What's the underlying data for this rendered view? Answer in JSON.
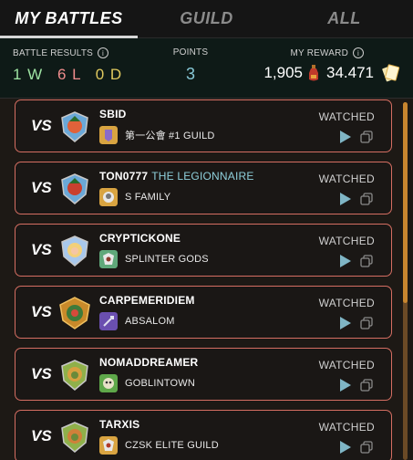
{
  "tabs": [
    {
      "label": "MY BATTLES"
    },
    {
      "label": "GUILD"
    },
    {
      "label": "ALL"
    }
  ],
  "stats": {
    "results_label": "BATTLE RESULTS",
    "wins": "1 W",
    "losses": "6 L",
    "draws": "0 D",
    "points_label": "POINTS",
    "points": "3",
    "reward_label": "MY REWARD",
    "reward_potions": "1,905",
    "reward_cards": "34.471"
  },
  "battles": [
    {
      "vs": "VS",
      "name": "SBID",
      "title": "",
      "guild": "第一公會 #1 GUILD",
      "status": "WATCHED"
    },
    {
      "vs": "VS",
      "name": "TON0777",
      "title": "THE LEGIONNAIRE",
      "guild": "S FAMILY",
      "status": "WATCHED"
    },
    {
      "vs": "VS",
      "name": "CRYPTICKONE",
      "title": "",
      "guild": "SPLINTER GODS",
      "status": "WATCHED"
    },
    {
      "vs": "VS",
      "name": "CARPEMERIDIEM",
      "title": "",
      "guild": "ABSALOM",
      "status": "WATCHED"
    },
    {
      "vs": "VS",
      "name": "NOMADDREAMER",
      "title": "",
      "guild": "GOBLINTOWN",
      "status": "WATCHED"
    },
    {
      "vs": "VS",
      "name": "TARXIS",
      "title": "",
      "guild": "CZSK ELITE GUILD",
      "status": "WATCHED"
    }
  ],
  "colors": {
    "accent_border": "#d56e62",
    "wins": "#9de2a2",
    "losses": "#ef8d8d",
    "draws": "#e0c95e",
    "points": "#87c8d6"
  }
}
